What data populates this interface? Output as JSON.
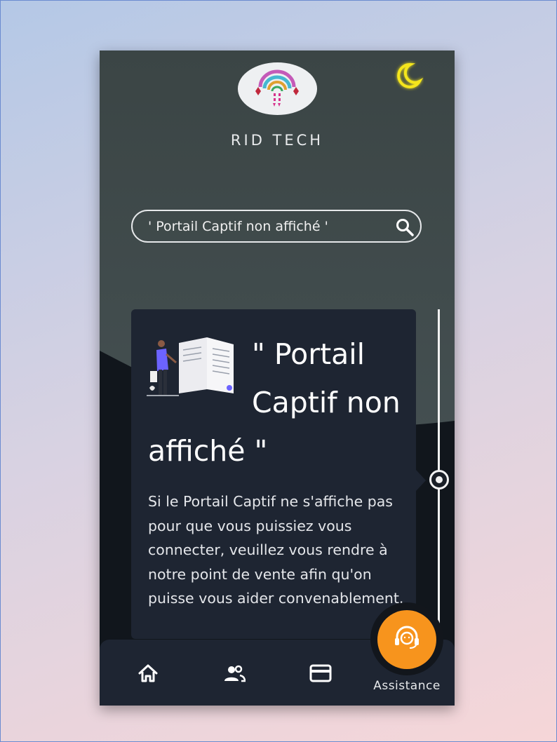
{
  "brand": {
    "name": "RID TECH"
  },
  "search": {
    "value": "' Portail Captif non affiché '",
    "icon": "search-icon"
  },
  "card": {
    "title": "\" Portail Captif non affiché \"",
    "body": "Si le Portail Captif ne s'affiche pas pour que vous puissiez vous connecter, veuillez vous rendre à notre point de vente afin qu'on puisse vous aider convenablement."
  },
  "nav": {
    "items": [
      {
        "icon": "home-icon"
      },
      {
        "icon": "users-icon"
      },
      {
        "icon": "credit-card-icon"
      }
    ],
    "assistance": {
      "label": "Assistance",
      "icon": "headset-icon"
    }
  },
  "theme": {
    "toggle_icon": "moon-icon",
    "moon_color": "#f5e61e",
    "accent": "#f7941d",
    "card_bg": "#1e2532"
  }
}
